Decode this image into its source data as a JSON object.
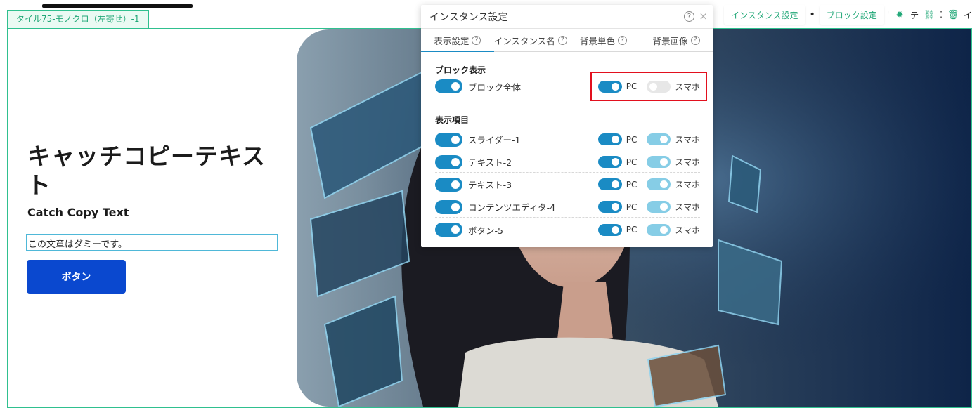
{
  "block": {
    "tag_label": "タイル75-モノクロ（左寄せ）-1"
  },
  "content": {
    "headline": "キャッチコピーテキスト",
    "subhead": "Catch Copy Text",
    "dummy_text": "この文章はダミーです。",
    "button_label": "ボタン"
  },
  "toolbar": {
    "instance_settings": "インスタンス設定",
    "separator": "•",
    "block_settings": "ブロック設定",
    "sep2": "'",
    "text_t": "テ",
    "sep3": "⁚",
    "text_i": "イ",
    "icons": [
      "sun-icon",
      "link-icon",
      "trash-icon",
      "help-icon"
    ]
  },
  "panel": {
    "title": "インスタンス設定",
    "help": "?",
    "close": "×",
    "tabs": [
      {
        "label": "表示設定",
        "active": true
      },
      {
        "label": "インスタンス名",
        "active": false
      },
      {
        "label": "背景単色",
        "active": false
      },
      {
        "label": "背景画像",
        "active": false
      }
    ],
    "block_display": {
      "heading": "ブロック表示",
      "row": {
        "label": "ブロック全体",
        "main": "on",
        "pc_label": "PC",
        "pc": "on",
        "sp_label": "スマホ",
        "sp": "off"
      }
    },
    "display_items": {
      "heading": "表示項目",
      "rows": [
        {
          "label": "スライダー-1",
          "main": "on",
          "pc_label": "PC",
          "pc": "on",
          "sp_label": "スマホ",
          "sp": "on-light"
        },
        {
          "label": "テキスト-2",
          "main": "on",
          "pc_label": "PC",
          "pc": "on",
          "sp_label": "スマホ",
          "sp": "on-light"
        },
        {
          "label": "テキスト-3",
          "main": "on",
          "pc_label": "PC",
          "pc": "on",
          "sp_label": "スマホ",
          "sp": "on-light"
        },
        {
          "label": "コンテンツエディタ-4",
          "main": "on",
          "pc_label": "PC",
          "pc": "on",
          "sp_label": "スマホ",
          "sp": "on-light"
        },
        {
          "label": "ボタン-5",
          "main": "on",
          "pc_label": "PC",
          "pc": "on",
          "sp_label": "スマホ",
          "sp": "on-light"
        }
      ]
    }
  },
  "colors": {
    "accent_green": "#2fc08f",
    "toggle_on": "#1a8bc4",
    "toggle_light": "#86cde6",
    "button_blue": "#0a48cf",
    "highlight_red": "#e2101e"
  }
}
